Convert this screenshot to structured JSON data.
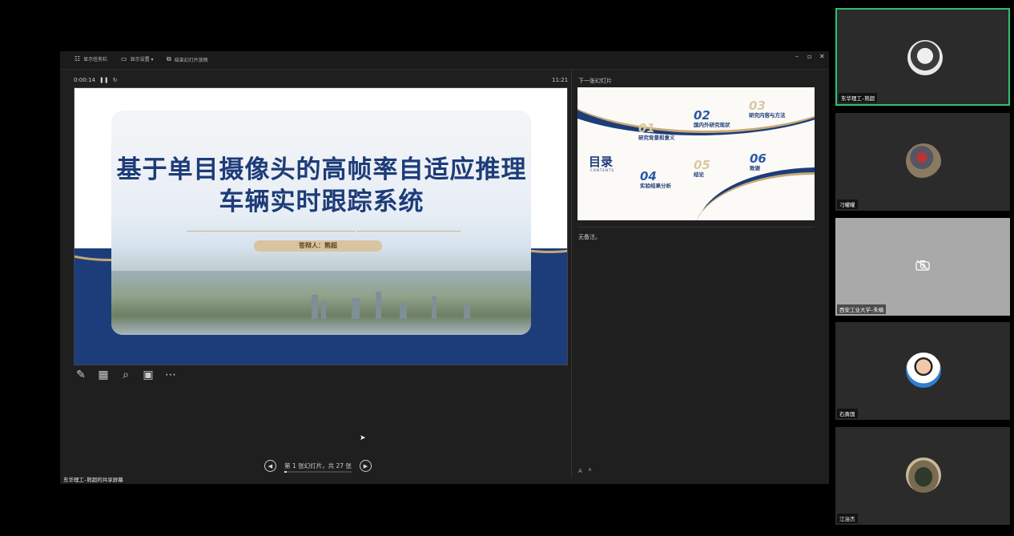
{
  "toolbar": {
    "show_taskbar": "显示任务栏",
    "display_settings": "显示设置 ▾",
    "end_show": "结束幻灯片放映",
    "win_min": "–",
    "win_max": "▫",
    "win_close": "✕"
  },
  "presenter": {
    "elapsed": "0:00:14",
    "pause_icon": "pause-icon",
    "restart_icon": "restart-icon",
    "clock": "11:21"
  },
  "current_slide": {
    "title_line1": "基于单目摄像头的高帧率自适应推理",
    "title_line2": "车辆实时跟踪系统",
    "presenter_label": "答辩人：熊超"
  },
  "next_slide": {
    "label": "下一张幻灯片",
    "heading": "目录",
    "heading_sub": "CONTENTS",
    "items": [
      {
        "num": "01",
        "label": "研究背景和意义"
      },
      {
        "num": "02",
        "label": "国内外研究现状"
      },
      {
        "num": "03",
        "label": "研究内容与方法"
      },
      {
        "num": "04",
        "label": "实验结果分析"
      },
      {
        "num": "05",
        "label": "结论"
      },
      {
        "num": "06",
        "label": "致谢"
      }
    ]
  },
  "notes": {
    "text": "无备注。",
    "font_up": "A",
    "font_down": "A"
  },
  "navigation": {
    "counter": "第 1 张幻灯片，共 27 张",
    "progress": 0.037,
    "prev": "◀",
    "next": "▶"
  },
  "share_caption": "东华理工–熊超的共享屏幕",
  "participants": [
    {
      "name": "东华理工–熊超",
      "active": true,
      "video": true
    },
    {
      "name": "刁曜曜",
      "active": false,
      "video": true
    },
    {
      "name": "西安工业大学–朱楠",
      "active": false,
      "video": false
    },
    {
      "name": "石勇国",
      "active": false,
      "video": true
    },
    {
      "name": "江治杰",
      "active": false,
      "video": true
    }
  ],
  "colors": {
    "navy": "#1c3d7a",
    "gold": "#c7a974",
    "speaker_border": "#2fbf71"
  }
}
